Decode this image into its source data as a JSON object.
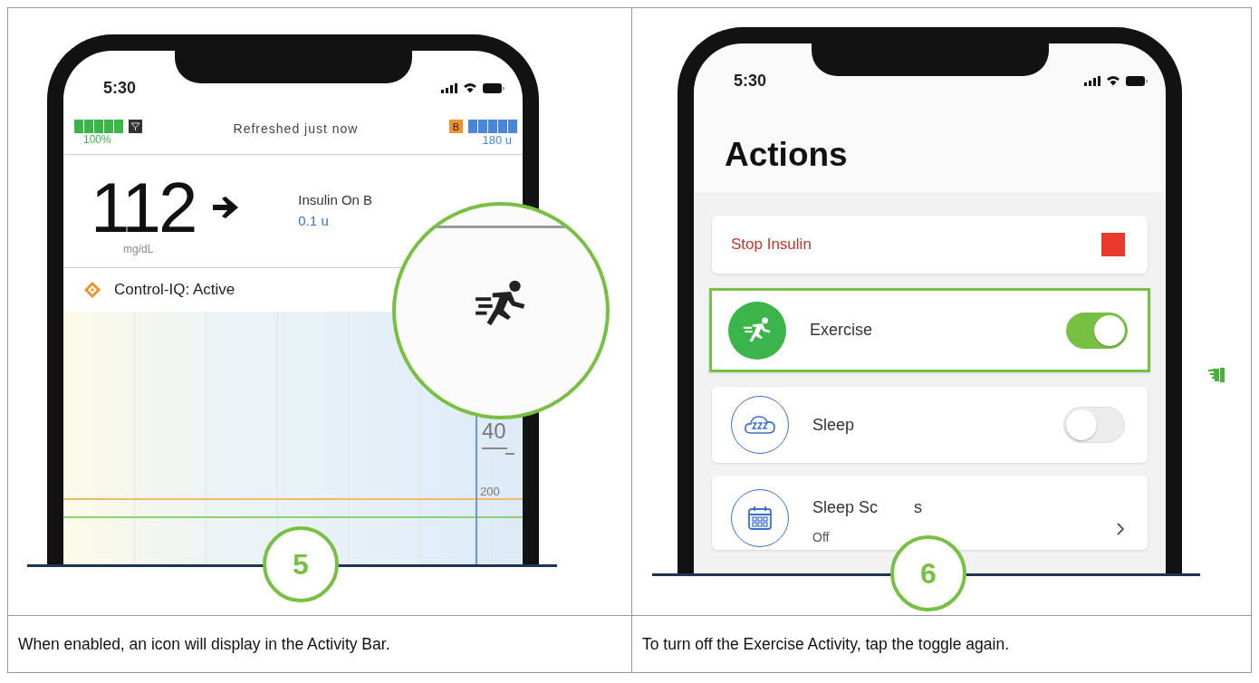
{
  "left_panel": {
    "step": "5",
    "caption": "When enabled, an icon will display in the Activity Bar.",
    "phone": {
      "time": "5:30",
      "battery_percent": "100%",
      "refreshed": "Refreshed just now",
      "reservoir_badge": "B",
      "insulin_remaining": "180 u",
      "glucose": "112",
      "glucose_unit": "mg/dL",
      "iob_label": "Insulin On B",
      "iob_value": "0.1 u",
      "control_iq": "Control-IQ: Active",
      "axis_labels": [
        "40",
        "200"
      ]
    }
  },
  "right_panel": {
    "step": "6",
    "caption": "To turn off the Exercise Activity, tap the toggle again.",
    "phone": {
      "time": "5:30",
      "title": "Actions",
      "items": [
        {
          "kind": "action",
          "label": "Stop Insulin",
          "highlighted": false
        },
        {
          "kind": "toggle",
          "label": "Exercise",
          "on": true,
          "highlighted": true
        },
        {
          "kind": "toggle",
          "label": "Sleep",
          "on": false,
          "highlighted": false
        },
        {
          "kind": "link",
          "label_parts": [
            "Sleep Sc",
            "s"
          ],
          "sublabel": "Off",
          "highlighted": false
        }
      ]
    }
  }
}
